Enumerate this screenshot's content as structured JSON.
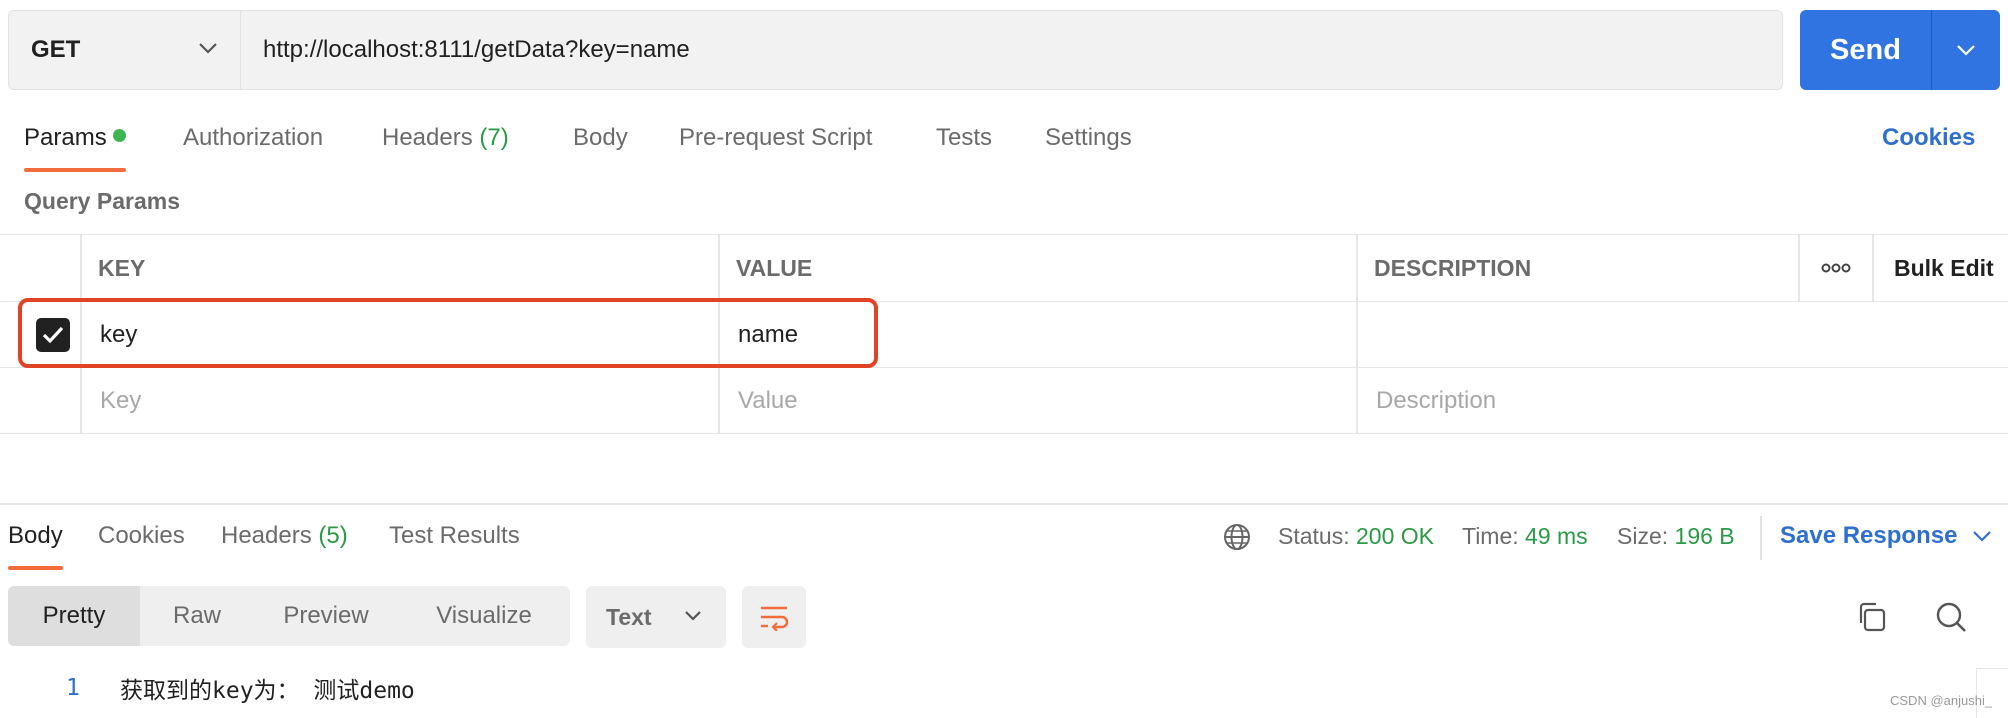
{
  "request": {
    "method": "GET",
    "url": "http://localhost:8111/getData?key=name",
    "send_label": "Send"
  },
  "request_tabs": [
    {
      "label": "Params",
      "active": true
    },
    {
      "label": "Authorization"
    },
    {
      "label": "Headers",
      "count": "(7)"
    },
    {
      "label": "Body"
    },
    {
      "label": "Pre-request Script"
    },
    {
      "label": "Tests"
    },
    {
      "label": "Settings"
    }
  ],
  "cookies_label": "Cookies",
  "query_params": {
    "title": "Query Params",
    "headers": {
      "key": "KEY",
      "value": "VALUE",
      "description": "DESCRIPTION",
      "more": "ooo",
      "bulk_edit": "Bulk Edit"
    },
    "rows": [
      {
        "checked": true,
        "key": "key",
        "value": "name",
        "description": ""
      }
    ],
    "placeholders": {
      "key": "Key",
      "value": "Value",
      "description": "Description"
    }
  },
  "response_tabs": [
    {
      "label": "Body",
      "active": true
    },
    {
      "label": "Cookies"
    },
    {
      "label": "Headers",
      "count": "(5)"
    },
    {
      "label": "Test Results"
    }
  ],
  "response_status": {
    "status_label": "Status:",
    "status_value": "200 OK",
    "time_label": "Time:",
    "time_value": "49 ms",
    "size_label": "Size:",
    "size_value": "196 B"
  },
  "save_response_label": "Save Response",
  "view_modes": [
    "Pretty",
    "Raw",
    "Preview",
    "Visualize"
  ],
  "format": "Text",
  "body_lines": [
    {
      "number": "1",
      "text": "获取到的key为： 测试demo"
    }
  ],
  "watermark": "CSDN @anjushi_",
  "colors": {
    "send": "#2f74e0",
    "accent": "#f26b3a",
    "success": "#2a9a47",
    "highlight": "#e14327",
    "link": "#2f6fd0"
  }
}
